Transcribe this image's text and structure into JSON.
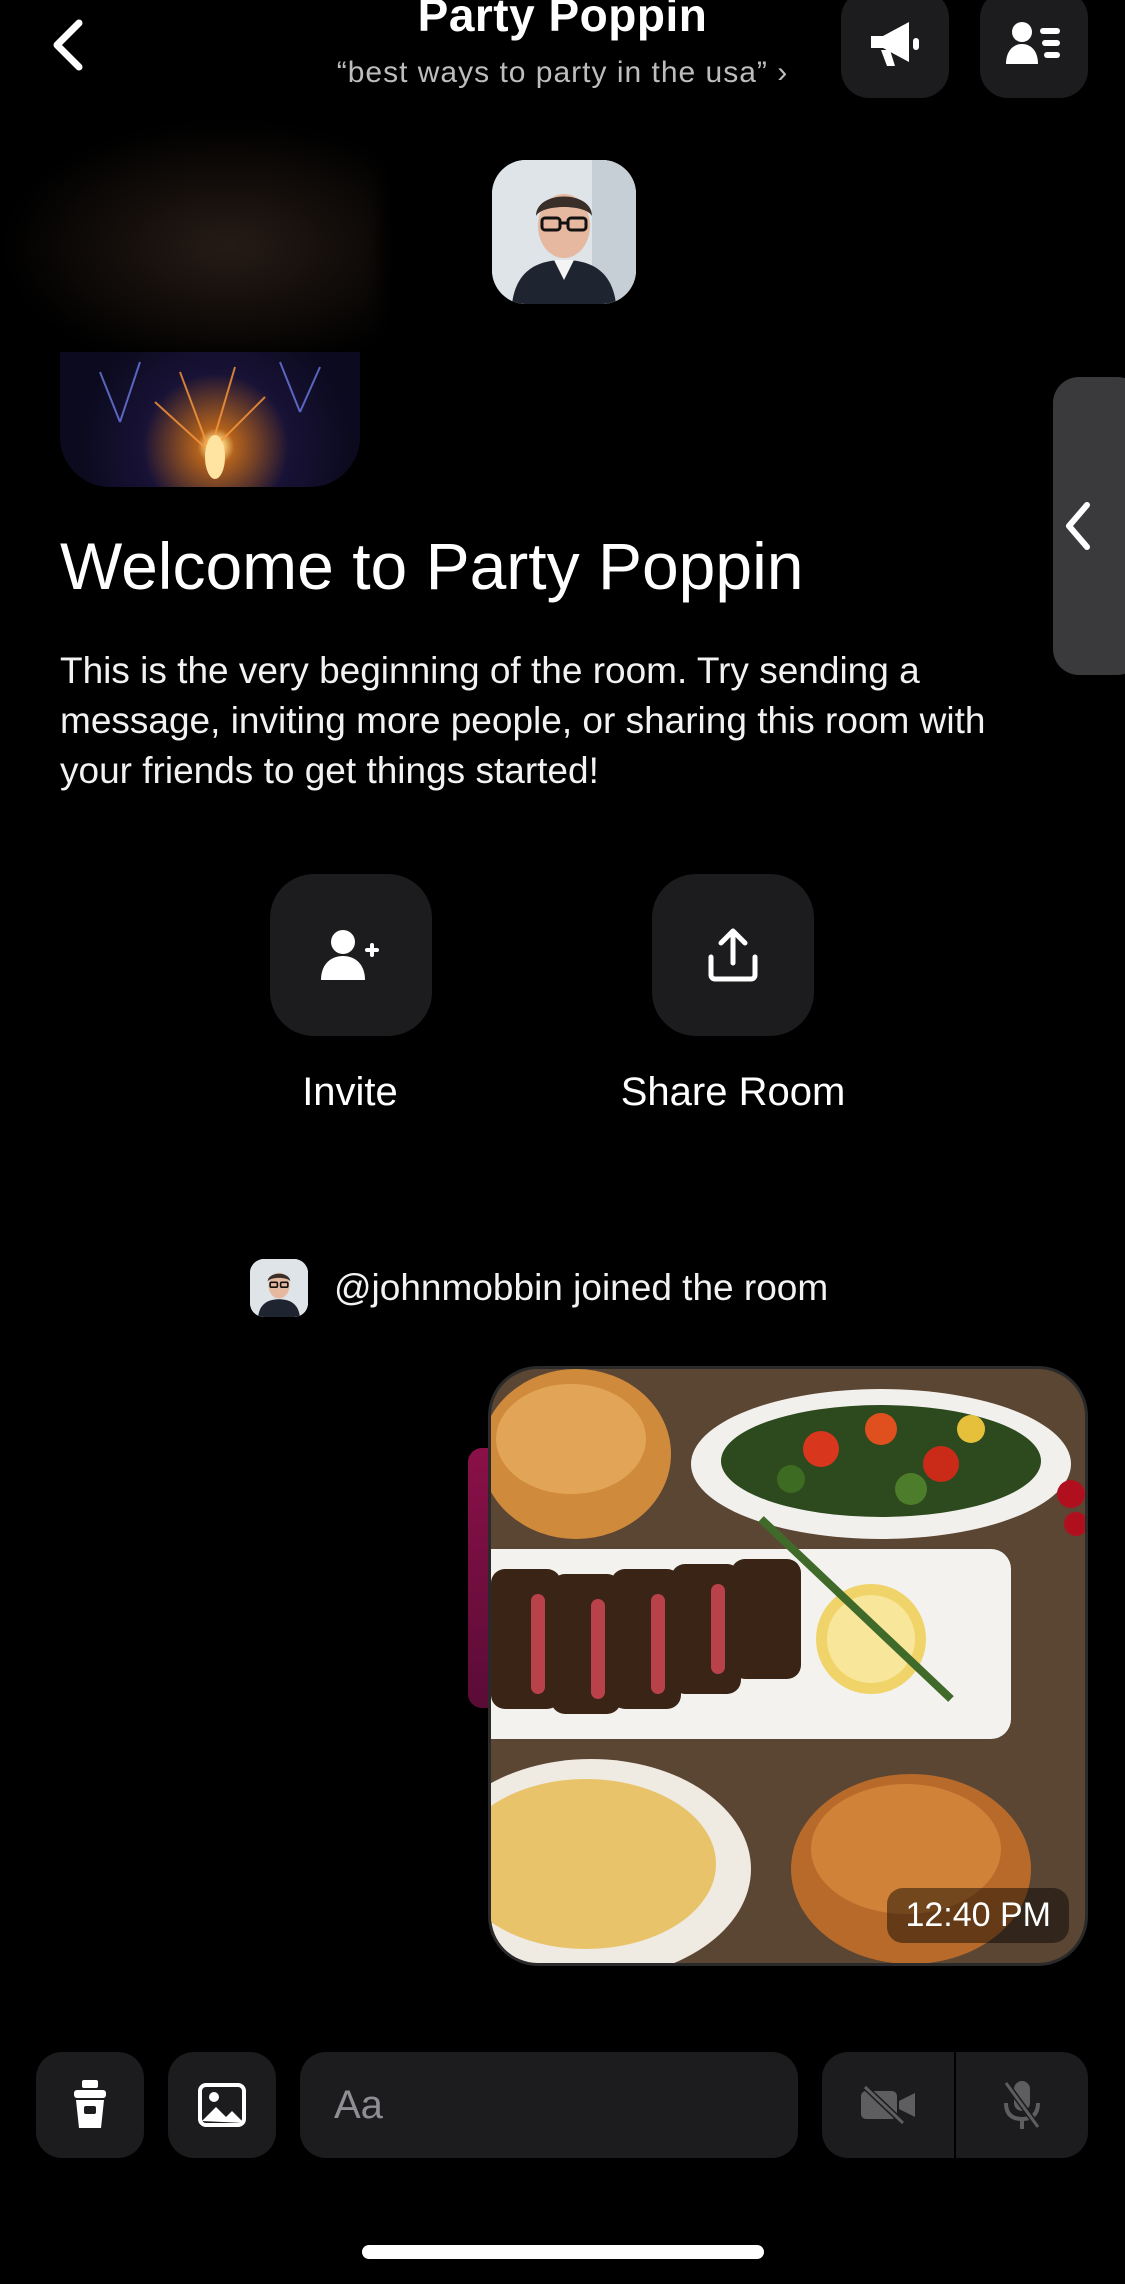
{
  "header": {
    "title": "Party Poppin",
    "subtitle": "“best ways to party in the usa” ›",
    "icons": [
      "chevron-left-icon",
      "megaphone-icon",
      "user-list-icon"
    ]
  },
  "welcome": {
    "heading": "Welcome to Party Poppin",
    "description": "This is the very beginning of the room. Try sending a message, inviting more people, or sharing this room with your friends to get things started!"
  },
  "actions": [
    {
      "label": "Invite",
      "icon": "add-user-icon"
    },
    {
      "label": "Share Room",
      "icon": "share-icon"
    }
  ],
  "events": {
    "join_text": "@johnmobbin joined the room"
  },
  "message": {
    "time": "12:40 PM",
    "image": "food-photo"
  },
  "composer": {
    "placeholder": "Aa",
    "icons": [
      "cup-icon",
      "image-icon",
      "emoji-icon",
      "video-off-icon",
      "mic-off-icon"
    ]
  },
  "colors": {
    "background": "#000000",
    "surface": "#1c1c1e",
    "side_tab": "#3a3a3c"
  }
}
